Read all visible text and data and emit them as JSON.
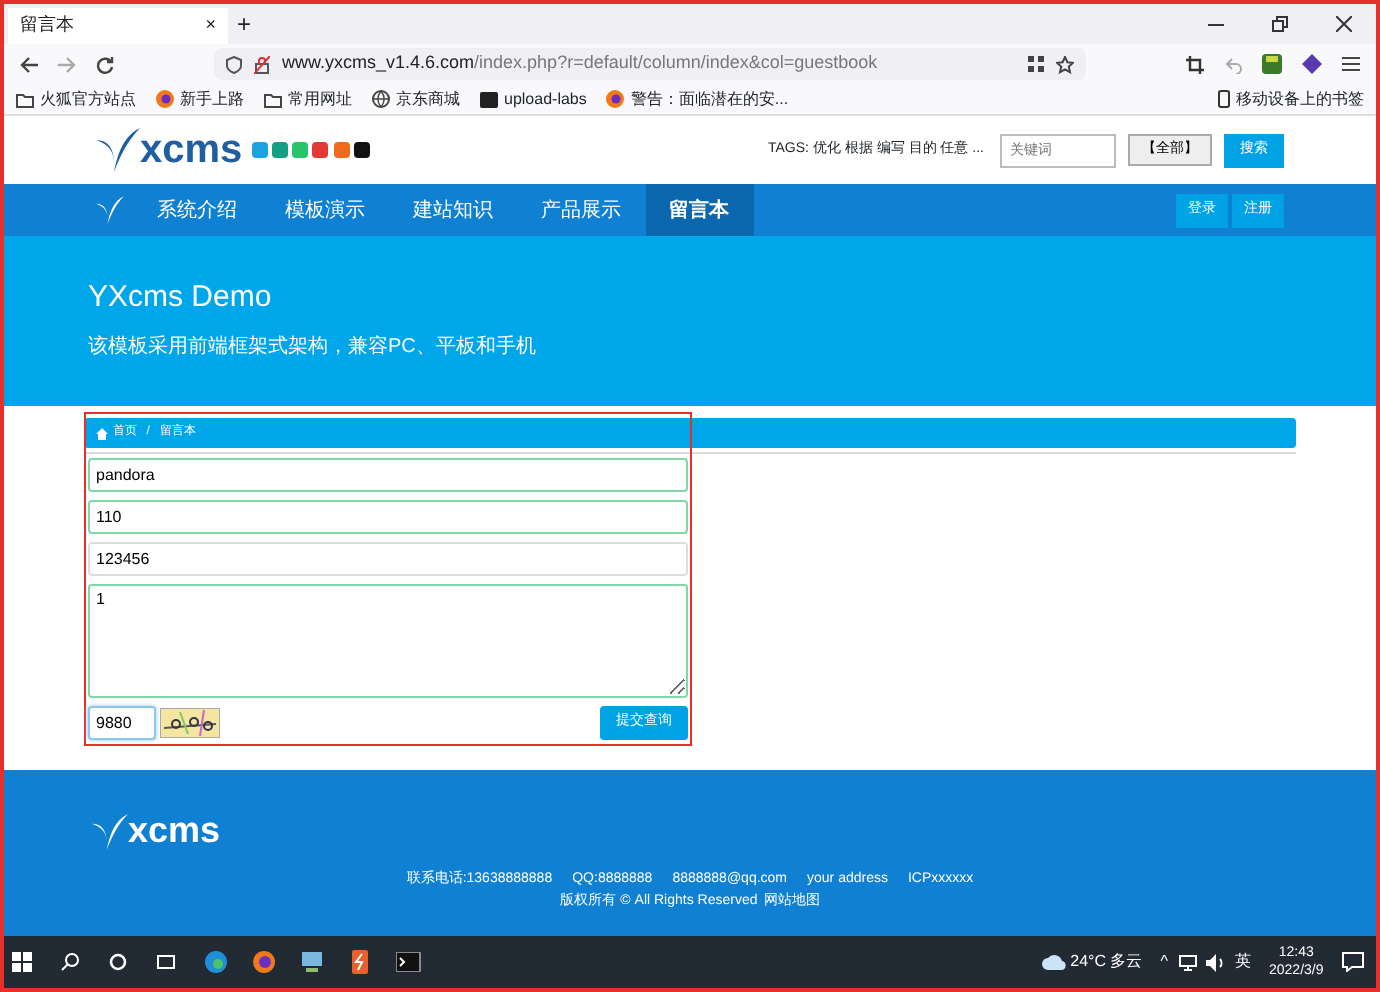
{
  "browser": {
    "tab": {
      "title": "留言本",
      "close": "×"
    },
    "new_tab": "+",
    "url": {
      "host": "www.yxcms_v1.4.6.com",
      "path": "/index.php?r=default/column/index&col=guestbook"
    },
    "bookmarks": [
      {
        "label": "火狐官方站点",
        "kind": "folder"
      },
      {
        "label": "新手上路",
        "kind": "firefox"
      },
      {
        "label": "常用网址",
        "kind": "folder"
      },
      {
        "label": "京东商城",
        "kind": "globe"
      },
      {
        "label": "upload-labs",
        "kind": "dark"
      },
      {
        "label": "警告：面临潜在的安...",
        "kind": "firefox"
      }
    ],
    "mobile_bookmarks": "移动设备上的书签"
  },
  "site": {
    "logo": "xcms",
    "theme_colors": [
      {
        "color": "#1aa3e0"
      },
      {
        "color": "#13a085"
      },
      {
        "color": "#27c46b"
      },
      {
        "color": "#e53935"
      },
      {
        "color": "#f26b1d"
      },
      {
        "color": "#111111"
      }
    ],
    "tags": "TAGS: 优化 根据 编写 目的 任意 ...",
    "search": {
      "placeholder": "关键词"
    },
    "scope_button": "【全部】",
    "search_button": "搜索",
    "nav": [
      {
        "label": "系统介绍",
        "selected": false
      },
      {
        "label": "模板演示",
        "selected": false
      },
      {
        "label": "建站知识",
        "selected": false
      },
      {
        "label": "产品展示",
        "selected": false
      },
      {
        "label": "留言本",
        "selected": true
      }
    ],
    "auth_buttons": [
      "登录",
      "注册"
    ],
    "hero": {
      "title": "YXcms Demo",
      "subtitle": "该模板采用前端框架式架构，兼容PC、平板和手机"
    },
    "breadcrumb": [
      "首页",
      "留言本"
    ],
    "breadcrumb_separator": "/",
    "form": {
      "fields": [
        {
          "kind": "input",
          "value": "pandora",
          "valid": true
        },
        {
          "kind": "input",
          "value": "110",
          "valid": true
        },
        {
          "kind": "input",
          "value": "123456",
          "valid": false
        },
        {
          "kind": "textarea",
          "value": "1",
          "valid": true
        }
      ],
      "captcha": {
        "value": "9880",
        "focused": true
      },
      "submit": "提交查询"
    },
    "footer": {
      "logo": "xcms",
      "contacts": [
        "联系电话:13638888888",
        "QQ:8888888",
        "8888888@qq.com",
        "your address",
        "ICPxxxxxx"
      ],
      "copyright": "版权所有 © All Rights Reserved",
      "sitemap": "网站地图"
    }
  },
  "taskbar": {
    "weather": "24°C 多云",
    "tray_caret": "^",
    "ime": "英",
    "time": "12:43",
    "date": "2022/3/9"
  }
}
